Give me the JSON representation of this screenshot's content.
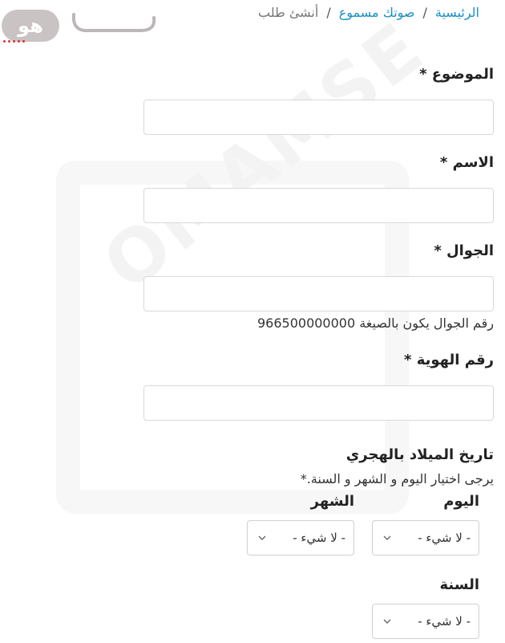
{
  "header": {
    "logo_text": "هو",
    "breadcrumb": {
      "home": "الرئيسية",
      "section": "صوتك مسموع",
      "current": "أنشئ طلب",
      "separator": "/"
    }
  },
  "watermark": "OMAMSE",
  "form": {
    "subject": {
      "label": "الموضوع *",
      "value": ""
    },
    "name": {
      "label": "الاسم *",
      "value": ""
    },
    "mobile": {
      "label": "الجوال *",
      "value": "",
      "help": "رقم الجوال يكون بالصيغة 966500000000"
    },
    "national_id": {
      "label": "رقم الهوية *",
      "value": ""
    },
    "birth_date": {
      "title": "تاريخ الميلاد بالهجري",
      "note": "يرجى اختيار اليوم و الشهر و السنة.*",
      "day": {
        "label": "اليوم",
        "selected": "- لا شيء -"
      },
      "month": {
        "label": "الشهر",
        "selected": "- لا شيء -"
      },
      "year": {
        "label": "السنة",
        "selected": "- لا شيء -"
      }
    }
  }
}
